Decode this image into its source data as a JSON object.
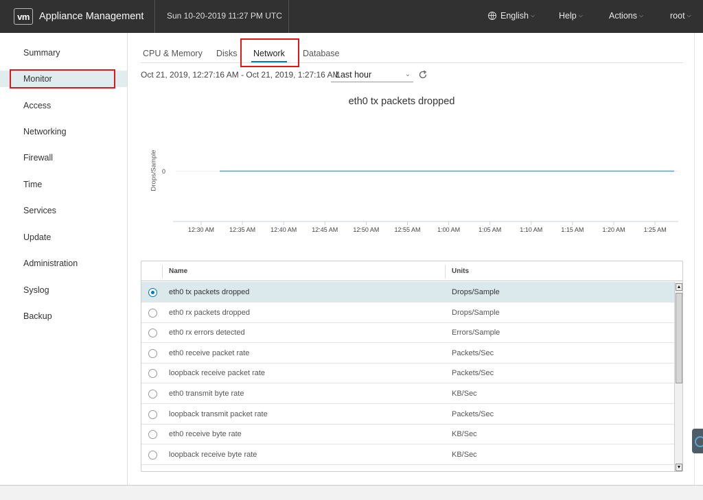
{
  "header": {
    "logo": "vm",
    "app_title": "Appliance Management",
    "datetime": "Sun 10-20-2019 11:27 PM UTC",
    "language": "English",
    "help": "Help",
    "actions": "Actions",
    "user": "root"
  },
  "sidebar": {
    "items": [
      {
        "label": "Summary"
      },
      {
        "label": "Monitor"
      },
      {
        "label": "Access"
      },
      {
        "label": "Networking"
      },
      {
        "label": "Firewall"
      },
      {
        "label": "Time"
      },
      {
        "label": "Services"
      },
      {
        "label": "Update"
      },
      {
        "label": "Administration"
      },
      {
        "label": "Syslog"
      },
      {
        "label": "Backup"
      }
    ],
    "active": "Monitor"
  },
  "tabs": [
    {
      "label": "CPU & Memory"
    },
    {
      "label": "Disks"
    },
    {
      "label": "Network"
    },
    {
      "label": "Database"
    }
  ],
  "active_tab": "Network",
  "range": {
    "text": "Oct 21, 2019, 12:27:16 AM - Oct 21, 2019, 1:27:16 AM",
    "selected": "Last hour"
  },
  "chart_data": {
    "type": "line",
    "title": "eth0 tx packets dropped",
    "ylabel": "Drops/Sample",
    "xlabel": "",
    "x_ticks": [
      "12:30 AM",
      "12:35 AM",
      "12:40 AM",
      "12:45 AM",
      "12:50 AM",
      "12:55 AM",
      "1:00 AM",
      "1:05 AM",
      "1:10 AM",
      "1:15 AM",
      "1:20 AM",
      "1:25 AM"
    ],
    "y_ticks": [
      "0"
    ],
    "series": [
      {
        "x": [
          "12:31 AM",
          "1:27 AM"
        ],
        "values": [
          0,
          0
        ],
        "color": "#4aa8d8"
      }
    ]
  },
  "table": {
    "columns": {
      "name": "Name",
      "units": "Units"
    },
    "rows": [
      {
        "name": "eth0 tx packets dropped",
        "units": "Drops/Sample",
        "selected": true
      },
      {
        "name": "eth0 rx packets dropped",
        "units": "Drops/Sample",
        "selected": false
      },
      {
        "name": "eth0 rx errors detected",
        "units": "Errors/Sample",
        "selected": false
      },
      {
        "name": "eth0 receive packet rate",
        "units": "Packets/Sec",
        "selected": false
      },
      {
        "name": "loopback receive packet rate",
        "units": "Packets/Sec",
        "selected": false
      },
      {
        "name": "eth0 transmit byte rate",
        "units": "KB/Sec",
        "selected": false
      },
      {
        "name": "loopback transmit packet rate",
        "units": "Packets/Sec",
        "selected": false
      },
      {
        "name": "eth0 receive byte rate",
        "units": "KB/Sec",
        "selected": false
      },
      {
        "name": "loopback receive byte rate",
        "units": "KB/Sec",
        "selected": false
      }
    ]
  },
  "colors": {
    "header_bg": "#313131",
    "accent": "#0079b8",
    "selected_row": "#dbe9ec",
    "highlight_box": "#e0161c",
    "series_line": "#4aa8d8"
  }
}
